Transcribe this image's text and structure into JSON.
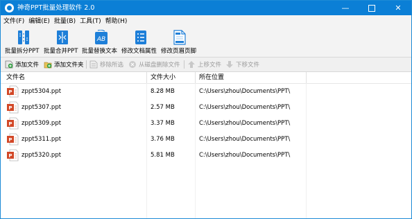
{
  "window": {
    "title": "神奇PPT批量处理软件 2.0",
    "controls": {
      "minimize": "—",
      "close": "✕"
    }
  },
  "menu": [
    {
      "label": "文件(F)"
    },
    {
      "label": "编辑(E)"
    },
    {
      "label": "批量(B)"
    },
    {
      "label": "工具(T)"
    },
    {
      "label": "帮助(H)"
    }
  ],
  "toolbar": [
    {
      "label": "批量拆分PPT",
      "icon": "split-ppt-icon"
    },
    {
      "label": "批量合并PPT",
      "icon": "merge-ppt-icon"
    },
    {
      "label": "批量替换文本",
      "icon": "replace-text-icon"
    },
    {
      "label": "修改文档属性",
      "icon": "document-properties-icon"
    },
    {
      "label": "修改页眉页脚",
      "icon": "header-footer-icon"
    }
  ],
  "subtoolbar": [
    {
      "label": "添加文件",
      "icon": "add-file-icon",
      "enabled": true
    },
    {
      "label": "添加文件夹",
      "icon": "add-folder-icon",
      "enabled": true
    },
    {
      "label": "移除所选",
      "icon": "remove-selected-icon",
      "enabled": false
    },
    {
      "label": "从磁盘删除文件",
      "icon": "delete-from-disk-icon",
      "enabled": false
    },
    {
      "label": "上移文件",
      "icon": "move-up-icon",
      "enabled": false
    },
    {
      "label": "下移文件",
      "icon": "move-down-icon",
      "enabled": false
    }
  ],
  "table": {
    "columns": [
      "文件名",
      "文件大小",
      "所在位置"
    ],
    "rows": [
      {
        "name": "zppt5304.ppt",
        "size": "8.28 MB",
        "location": "C:\\Users\\zhou\\Documents\\PPT\\"
      },
      {
        "name": "zppt5307.ppt",
        "size": "2.57 MB",
        "location": "C:\\Users\\zhou\\Documents\\PPT\\"
      },
      {
        "name": "zppt5309.ppt",
        "size": "3.37 MB",
        "location": "C:\\Users\\zhou\\Documents\\PPT\\"
      },
      {
        "name": "zppt5311.ppt",
        "size": "3.76 MB",
        "location": "C:\\Users\\zhou\\Documents\\PPT\\"
      },
      {
        "name": "zppt5320.ppt",
        "size": "5.81 MB",
        "location": "C:\\Users\\zhou\\Documents\\PPT\\"
      }
    ]
  },
  "colors": {
    "titlebar": "#0b7fd6",
    "toolbar_icon": "#1e7fd8",
    "ppt_icon": "#d24726"
  }
}
